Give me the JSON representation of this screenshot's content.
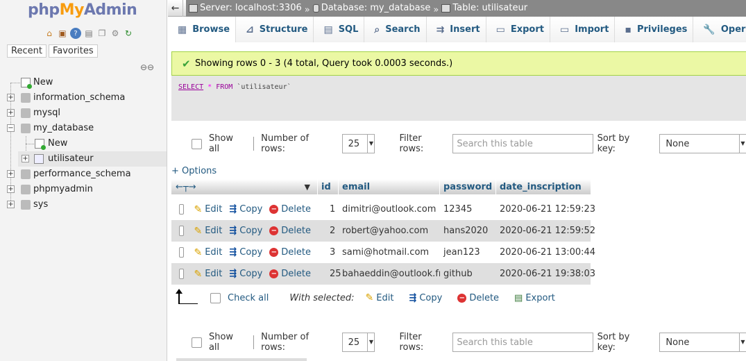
{
  "nav": {
    "logo": {
      "part1": "php",
      "part2": "My",
      "part3": "Admin"
    },
    "quick_icons": [
      "home-icon",
      "exit-icon",
      "help-icon",
      "docs-icon",
      "copy-icon",
      "settings-icon",
      "reload-icon"
    ],
    "recent_label": "Recent",
    "favorites_label": "Favorites",
    "tree": [
      {
        "label": "New",
        "level": 0,
        "type": "new"
      },
      {
        "label": "information_schema",
        "level": 0,
        "type": "db",
        "expander": "+"
      },
      {
        "label": "mysql",
        "level": 0,
        "type": "db",
        "expander": "+"
      },
      {
        "label": "my_database",
        "level": 0,
        "type": "db",
        "expander": "−"
      },
      {
        "label": "New",
        "level": 1,
        "type": "new"
      },
      {
        "label": "utilisateur",
        "level": 1,
        "type": "table",
        "expander": "+",
        "selected": true
      },
      {
        "label": "performance_schema",
        "level": 0,
        "type": "db",
        "expander": "+"
      },
      {
        "label": "phpmyadmin",
        "level": 0,
        "type": "db",
        "expander": "+"
      },
      {
        "label": "sys",
        "level": 0,
        "type": "db",
        "expander": "+"
      }
    ]
  },
  "breadcrumb": {
    "server": "Server: localhost:3306",
    "database": "Database: my_database",
    "table": "Table: utilisateur",
    "separator": "»"
  },
  "tabs": [
    {
      "label": "Browse",
      "icon": "browse-icon",
      "active": true
    },
    {
      "label": "Structure",
      "icon": "structure-icon"
    },
    {
      "label": "SQL",
      "icon": "sql-icon"
    },
    {
      "label": "Search",
      "icon": "search-icon"
    },
    {
      "label": "Insert",
      "icon": "insert-icon"
    },
    {
      "label": "Export",
      "icon": "export-icon"
    },
    {
      "label": "Import",
      "icon": "import-icon"
    },
    {
      "label": "Privileges",
      "icon": "privileges-icon"
    },
    {
      "label": "Operat",
      "icon": "operations-icon"
    }
  ],
  "message": {
    "success": "Showing rows 0 - 3 (4 total, Query took 0.0003 seconds.)"
  },
  "query": {
    "select": "SELECT",
    "star": "*",
    "from": "FROM",
    "table": "`utilisateur`"
  },
  "controls": {
    "show_all": "Show all",
    "number_of_rows_label": "Number of rows:",
    "number_of_rows_value": "25",
    "filter_label": "Filter rows:",
    "filter_placeholder": "Search this table",
    "sort_label": "Sort by key:",
    "sort_value": "None"
  },
  "options_link": "+ Options",
  "table": {
    "columns": [
      "id",
      "email",
      "password",
      "date_inscription"
    ],
    "action_labels": {
      "edit": "Edit",
      "copy": "Copy",
      "delete": "Delete"
    },
    "rows": [
      {
        "id": "1",
        "email": "dimitri@outlook.com",
        "password": "12345",
        "date": "2020-06-21 12:59:23"
      },
      {
        "id": "2",
        "email": "robert@yahoo.com",
        "password": "hans2020",
        "date": "2020-06-21 12:59:52"
      },
      {
        "id": "3",
        "email": "sami@hotmail.com",
        "password": "jean123",
        "date": "2020-06-21 13:00:44"
      },
      {
        "id": "25",
        "email": "bahaeddin@outlook.fr",
        "password": "github",
        "date": "2020-06-21 19:38:03"
      }
    ]
  },
  "bulk": {
    "check_all": "Check all",
    "with_selected": "With selected:",
    "edit": "Edit",
    "copy": "Copy",
    "delete": "Delete",
    "export": "Export"
  }
}
